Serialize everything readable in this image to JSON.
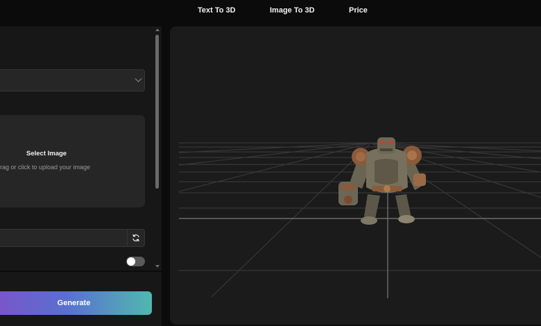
{
  "nav": {
    "text_to_3d": "Text To 3D",
    "image_to_3d": "Image To 3D",
    "price": "Price"
  },
  "upload": {
    "title": "Select Image",
    "hint": "rag or click to upload your image"
  },
  "actions": {
    "generate": "Generate"
  },
  "colors": {
    "background": "#0b0b0b",
    "panel": "#171717",
    "field": "#262626",
    "viewer": "#1b1b1b",
    "generate_gradient": [
      "#7a55c9",
      "#5a6fd0",
      "#50b8b0"
    ]
  },
  "icons": {
    "dropdown": "chevron-down-icon",
    "refresh": "refresh-icon"
  }
}
